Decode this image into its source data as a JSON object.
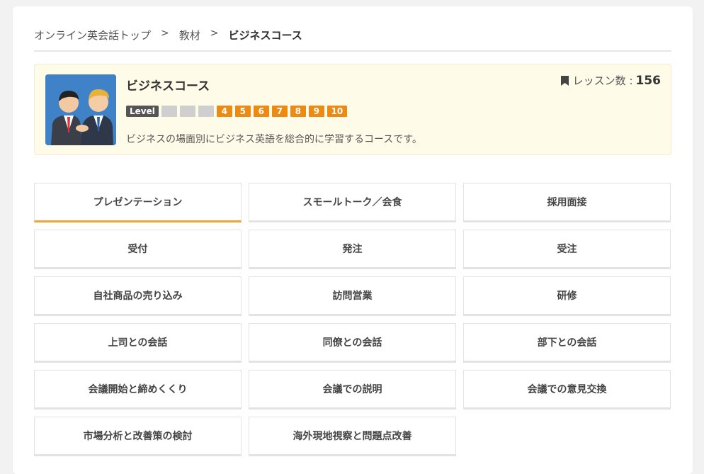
{
  "breadcrumb": {
    "items": [
      "オンライン英会話トップ",
      "教材"
    ],
    "separator": ">",
    "current": "ビジネスコース"
  },
  "course": {
    "title": "ビジネスコース",
    "lesson_label": "レッスン数 :",
    "lesson_count": "156",
    "level_label": "Level",
    "levels_inactive": [
      "",
      "",
      ""
    ],
    "levels_active": [
      "4",
      "5",
      "6",
      "7",
      "8",
      "9",
      "10"
    ],
    "description": "ビジネスの場面別にビジネス英語を総合的に学習するコースです。",
    "thumbnail_icon": "business-handshake-illustration",
    "colors": {
      "level_active": "#ec8a12",
      "level_inactive": "#cfcfcf",
      "tab_active": "#f4a233",
      "card_bg": "#fffbe9"
    }
  },
  "topics": [
    "プレゼンテーション",
    "スモールトーク／会食",
    "採用面接",
    "受付",
    "発注",
    "受注",
    "自社商品の売り込み",
    "訪問営業",
    "研修",
    "上司との会話",
    "同僚との会話",
    "部下との会話",
    "会議開始と締めくくり",
    "会議での説明",
    "会議での意見交換",
    "市場分析と改善策の検討",
    "海外現地視察と問題点改善"
  ],
  "active_topic": "プレゼンテーション"
}
